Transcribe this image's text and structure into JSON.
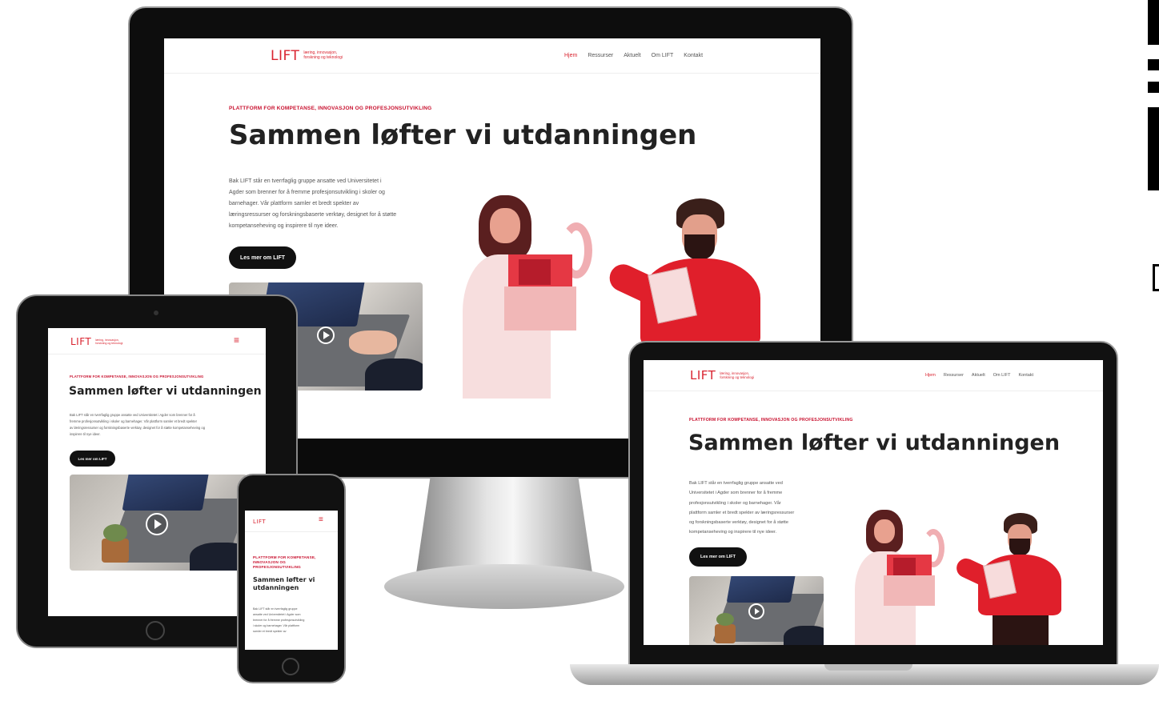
{
  "site": {
    "logo": "LIFT",
    "logo_sub_1": "læring, innovasjon,",
    "logo_sub_2": "forskning og teknologi",
    "nav": [
      "Hjem",
      "Ressurser",
      "Aktuelt",
      "Om LIFT",
      "Kontakt"
    ],
    "eyebrow": "PLATTFORM FOR KOMPETANSE, INNOVASJON OG PROFESJONSUTVIKLING",
    "eyebrow_phone_1": "PLATTFORM FOR KOMPETANSE,",
    "eyebrow_phone_2": "INNOVASJON OG",
    "eyebrow_phone_3": "PROFESJONSUTVIKLING",
    "headline": "Sammen løfter vi utdanningen",
    "headline_phone_1": "Sammen løfter vi",
    "headline_phone_2": "utdanningen",
    "body_lines_desktop": [
      "Bak LIFT står en tverrfaglig gruppe ansatte ved Universitetet i",
      "Agder som brenner for å fremme profesjonsutvikling i skoler og",
      "barnehager. Vår plattform samler et bredt spekter av",
      "læringsressurser og forskningsbaserte verktøy, designet for å støtte",
      "kompetanseheving og inspirere til nye ideer."
    ],
    "body_lines_laptop": [
      "Bak LIFT står en tverrfaglig gruppe ansatte ved",
      "Universitetet i Agder som brenner for å fremme",
      "profesjonsutvikling i skoler og barnehager. Vår",
      "plattform samler et bredt spekter av læringsressurser",
      "og forskningsbaserte verktøy, designet for å støtte",
      "kompetanseheving og inspirere til nye ideer."
    ],
    "body_lines_tablet": [
      "Bak LIFT står en tverrfaglig gruppe ansatte ved Universitetet i Agder som brenner for å",
      "fremme profesjonsutvikling i skoler og barnehager. Vår plattform samler et bredt spekter",
      "av læringsressurser og forskningsbaserte verktøy, designet for å støtte kompetanseheving og",
      "inspirere til nye ideer."
    ],
    "body_lines_phone": [
      "Bak LIFT står en tverrfaglig gruppe",
      "ansatte ved Universitetet i Agder som",
      "brenner for å fremme profesjonsutvikling",
      "i skoler og barnehager. Vår plattform",
      "samler et bredt spekter av"
    ],
    "cta": "Les mer om LIFT"
  },
  "colors": {
    "brand_red": "#d9232f",
    "cta_bg": "#111111"
  },
  "icons": {
    "hamburger": "hamburger-menu-icon",
    "play": "play-icon"
  }
}
